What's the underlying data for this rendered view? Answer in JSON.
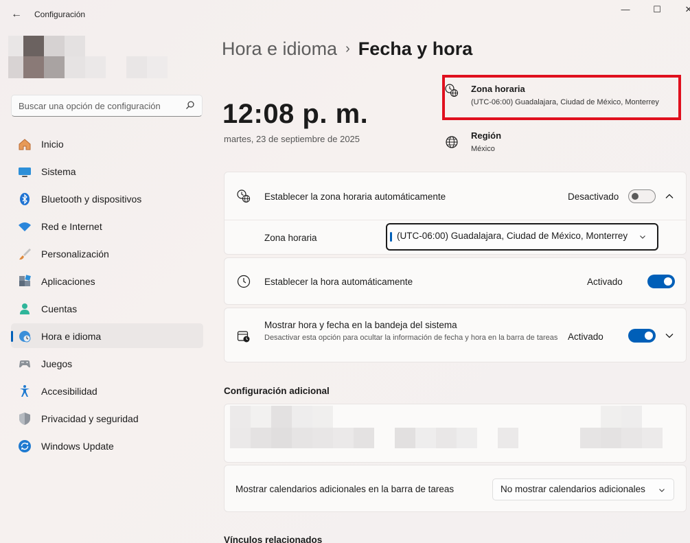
{
  "window": {
    "back_glyph": "←",
    "title": "Configuración",
    "minimize_glyph": "—",
    "maximize_glyph": "☐",
    "close_glyph": "✕"
  },
  "search": {
    "placeholder": "Buscar una opción de configuración"
  },
  "sidebar": {
    "items": [
      {
        "label": "Inicio",
        "icon": "home-icon",
        "active": false
      },
      {
        "label": "Sistema",
        "icon": "system-monitor-icon",
        "active": false
      },
      {
        "label": "Bluetooth y dispositivos",
        "icon": "bluetooth-icon",
        "active": false
      },
      {
        "label": "Red e Internet",
        "icon": "wifi-icon",
        "active": false
      },
      {
        "label": "Personalización",
        "icon": "paintbrush-icon",
        "active": false
      },
      {
        "label": "Aplicaciones",
        "icon": "apps-icon",
        "active": false
      },
      {
        "label": "Cuentas",
        "icon": "person-icon",
        "active": false
      },
      {
        "label": "Hora e idioma",
        "icon": "clock-globe-icon",
        "active": true
      },
      {
        "label": "Juegos",
        "icon": "gamepad-icon",
        "active": false
      },
      {
        "label": "Accesibilidad",
        "icon": "accessibility-icon",
        "active": false
      },
      {
        "label": "Privacidad y seguridad",
        "icon": "shield-icon",
        "active": false
      },
      {
        "label": "Windows Update",
        "icon": "update-icon",
        "active": false
      }
    ]
  },
  "header": {
    "parent": "Hora e idioma",
    "separator": "›",
    "current": "Fecha y hora"
  },
  "clock": {
    "time": "12:08 p. m.",
    "date": "martes, 23 de septiembre de 2025"
  },
  "info": {
    "timezone_title": "Zona horaria",
    "timezone_value": "(UTC-06:00) Guadalajara, Ciudad de México, Monterrey",
    "region_title": "Región",
    "region_value": "México"
  },
  "settings": {
    "auto_timezone": {
      "label": "Establecer la zona horaria automáticamente",
      "state": "Desactivado",
      "on": false,
      "timezone_label": "Zona horaria",
      "timezone_value": "(UTC-06:00) Guadalajara, Ciudad de México, Monterrey"
    },
    "auto_time": {
      "label": "Establecer la hora automáticamente",
      "state": "Activado",
      "on": true
    },
    "tray": {
      "label": "Mostrar hora y fecha en la bandeja del sistema",
      "description": "Desactivar esta opción para ocultar la información de fecha y hora en la barra de tareas",
      "state": "Activado",
      "on": true
    }
  },
  "additional": {
    "title": "Configuración adicional",
    "calendars_label": "Mostrar calendarios adicionales en la barra de tareas",
    "calendars_value": "No mostrar calendarios adicionales"
  },
  "related": {
    "title": "Vínculos relacionados"
  },
  "colors": {
    "accent": "#005fb8",
    "highlight": "#e0101e"
  }
}
